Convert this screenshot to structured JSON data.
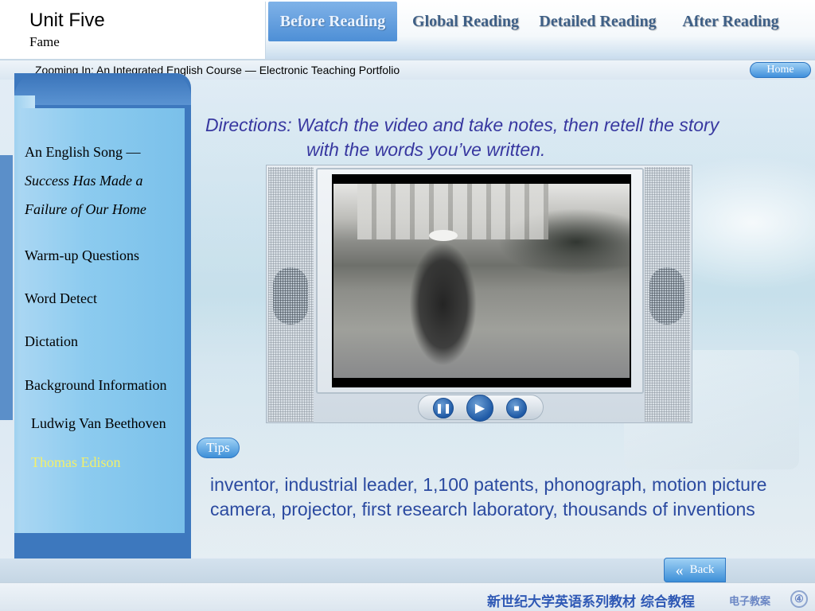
{
  "header": {
    "unit_title": "Unit Five",
    "unit_subtitle": "Fame",
    "tabs": [
      {
        "label": "Before Reading",
        "active": true
      },
      {
        "label": "Global Reading",
        "active": false
      },
      {
        "label": "Detailed Reading",
        "active": false
      },
      {
        "label": "After Reading",
        "active": false
      }
    ]
  },
  "subheader": {
    "course_title": "Zooming In: An Integrated English Course — Electronic Teaching Portfolio",
    "home_label": "Home"
  },
  "sidebar": {
    "items": [
      {
        "label": "An English Song —"
      },
      {
        "label": "Success Has Made a"
      },
      {
        "label": "Failure of Our Home"
      },
      {
        "label": "Warm-up Questions"
      },
      {
        "label": "Word Detect"
      },
      {
        "label": "Dictation"
      },
      {
        "label": "Background Information"
      },
      {
        "label": "Ludwig Van Beethoven"
      },
      {
        "label": "Thomas Edison",
        "active": true
      }
    ]
  },
  "main": {
    "directions_line1": "Directions: Watch the video and take notes, then retell the story",
    "directions_line2": "with the words you’ve written.",
    "tips_label": "Tips",
    "tips_text": "inventor, industrial leader, 1,100 patents, phonograph, motion picture camera, projector, first research laboratory, thousands of inventions"
  },
  "player": {
    "controls": [
      "pause",
      "play",
      "stop"
    ]
  },
  "footer": {
    "back_label": "Back",
    "publisher_text": "新世纪大学英语系列教材 综合教程",
    "portfolio_text": "电子教案",
    "page_number": "④"
  },
  "colors": {
    "accent_blue": "#3d8fd8",
    "active_item": "#f3f06a",
    "directions_text": "#3838a0"
  }
}
